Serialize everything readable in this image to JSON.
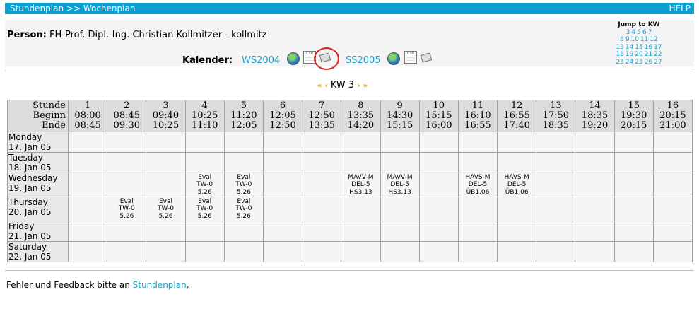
{
  "header": {
    "crumb_1": "Stundenplan",
    "crumb_sep": ">>",
    "crumb_2": "Wochenplan",
    "help": "HELP"
  },
  "person": {
    "label": "Person:",
    "value": "FH-Prof. Dipl.-Ing. Christian Kollmitzer - kollmitz"
  },
  "calendar": {
    "label": "Kalender:",
    "semester_1": "WS2004",
    "semester_2": "SS2005"
  },
  "jump": {
    "title": "Jump to KW",
    "rows": [
      [
        "3",
        "4",
        "5",
        "6",
        "7"
      ],
      [
        "8",
        "9",
        "10",
        "11",
        "12"
      ],
      [
        "13",
        "14",
        "15",
        "16",
        "17"
      ],
      [
        "18",
        "19",
        "20",
        "21",
        "22"
      ],
      [
        "23",
        "24",
        "25",
        "26",
        "27"
      ]
    ]
  },
  "week": {
    "label": "KW 3",
    "first": "«",
    "prev": "‹",
    "next": "›",
    "last": "»"
  },
  "grid": {
    "row_labels": [
      "Stunde",
      "Beginn",
      "Ende"
    ],
    "periods": [
      {
        "n": "1",
        "b": "08:00",
        "e": "08:45"
      },
      {
        "n": "2",
        "b": "08:45",
        "e": "09:30"
      },
      {
        "n": "3",
        "b": "09:40",
        "e": "10:25"
      },
      {
        "n": "4",
        "b": "10:25",
        "e": "11:10"
      },
      {
        "n": "5",
        "b": "11:20",
        "e": "12:05"
      },
      {
        "n": "6",
        "b": "12:05",
        "e": "12:50"
      },
      {
        "n": "7",
        "b": "12:50",
        "e": "13:35"
      },
      {
        "n": "8",
        "b": "13:35",
        "e": "14:20"
      },
      {
        "n": "9",
        "b": "14:30",
        "e": "15:15"
      },
      {
        "n": "10",
        "b": "15:15",
        "e": "16:00"
      },
      {
        "n": "11",
        "b": "16:10",
        "e": "16:55"
      },
      {
        "n": "12",
        "b": "16:55",
        "e": "17:40"
      },
      {
        "n": "13",
        "b": "17:50",
        "e": "18:35"
      },
      {
        "n": "14",
        "b": "18:35",
        "e": "19:20"
      },
      {
        "n": "15",
        "b": "19:30",
        "e": "20:15"
      },
      {
        "n": "16",
        "b": "20:15",
        "e": "21:00"
      }
    ],
    "days": [
      {
        "name": "Monday",
        "date": "17. Jan 05",
        "cells": [
          [],
          [],
          [],
          [],
          [],
          [],
          [],
          [],
          [],
          [],
          [],
          [],
          [],
          [],
          [],
          []
        ]
      },
      {
        "name": "Tuesday",
        "date": "18. Jan 05",
        "cells": [
          [],
          [],
          [],
          [],
          [],
          [],
          [],
          [],
          [],
          [],
          [],
          [],
          [],
          [],
          [],
          []
        ]
      },
      {
        "name": "Wednesday",
        "date": "19. Jan 05",
        "cells": [
          [],
          [],
          [],
          [
            "Eval",
            "TW-0",
            "5.26"
          ],
          [
            "Eval",
            "TW-0",
            "5.26"
          ],
          [],
          [],
          [
            "MAVV-M",
            "DEL-5",
            "HS3.13"
          ],
          [
            "MAVV-M",
            "DEL-5",
            "HS3.13"
          ],
          [],
          [
            "HAVS-M",
            "DEL-5",
            "ÜB1.06"
          ],
          [
            "HAVS-M",
            "DEL-5",
            "ÜB1.06"
          ],
          [],
          [],
          [],
          []
        ]
      },
      {
        "name": "Thursday",
        "date": "20. Jan 05",
        "cells": [
          [],
          [
            "Eval",
            "TW-0",
            "5.26"
          ],
          [
            "Eval",
            "TW-0",
            "5.26"
          ],
          [
            "Eval",
            "TW-0",
            "5.26"
          ],
          [
            "Eval",
            "TW-0",
            "5.26"
          ],
          [],
          [],
          [],
          [],
          [],
          [],
          [],
          [],
          [],
          [],
          []
        ]
      },
      {
        "name": "Friday",
        "date": "21. Jan 05",
        "cells": [
          [],
          [],
          [],
          [],
          [],
          [],
          [],
          [],
          [],
          [],
          [],
          [],
          [],
          [],
          [],
          []
        ]
      },
      {
        "name": "Saturday",
        "date": "22. Jan 05",
        "cells": [
          [],
          [],
          [],
          [],
          [],
          [],
          [],
          [],
          [],
          [],
          [],
          [],
          [],
          [],
          [],
          []
        ]
      }
    ]
  },
  "footer": {
    "text": "Fehler und Feedback bitte an",
    "link": "Stundenplan",
    "end": "."
  },
  "icons": {
    "globe": "globe-icon",
    "csv": "csv-export-icon",
    "print": "print-icon"
  },
  "colors": {
    "accent": "#0a9fd1",
    "link": "#1aa0c8",
    "highlight": "#e02020"
  }
}
